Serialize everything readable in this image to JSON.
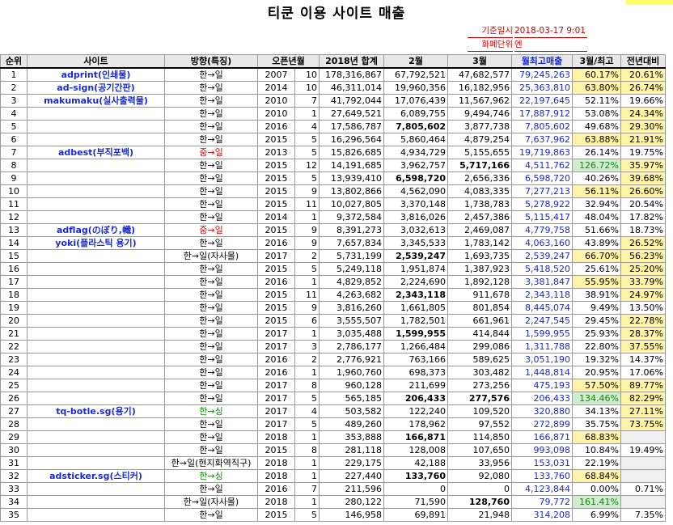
{
  "title": "티쿤 이용 사이트 매출",
  "meta": {
    "base_date_label": "기준일시",
    "base_date_value": "2018-03-17 9:01",
    "currency_label": "화폐단위",
    "currency_value": "엔"
  },
  "headers": [
    "순위",
    "사이트",
    "방향(특징)",
    "오픈년월",
    "2018년 합계",
    "2월",
    "3월",
    "월최고매출",
    "3월/최고",
    "전년대비"
  ],
  "rows": [
    {
      "rank": "1",
      "site": "adprint(인쇄물)",
      "dir": "한→일",
      "dirc": "",
      "y": "2007",
      "m": "10",
      "total": "178,316,867",
      "feb": "67,792,521",
      "mar": "47,682,577",
      "max": "79,245,263",
      "ratio": "60.17%",
      "rc": "ylw",
      "yoy": "20.61%",
      "yc": "ylw",
      "fb": false,
      "mb": false
    },
    {
      "rank": "2",
      "site": "ad-sign(공기간판)",
      "dir": "한→일",
      "dirc": "",
      "y": "2014",
      "m": "10",
      "total": "46,311,014",
      "feb": "19,960,356",
      "mar": "16,182,956",
      "max": "25,363,810",
      "ratio": "63.80%",
      "rc": "ylw",
      "yoy": "26.74%",
      "yc": "ylw",
      "fb": false,
      "mb": false
    },
    {
      "rank": "3",
      "site": "makumaku(실사출력물)",
      "dir": "한→일",
      "dirc": "",
      "y": "2010",
      "m": "7",
      "total": "41,792,044",
      "feb": "17,076,439",
      "mar": "11,567,962",
      "max": "22,197,645",
      "ratio": "52.11%",
      "rc": "",
      "yoy": "19.66%",
      "yc": "",
      "fb": false,
      "mb": false
    },
    {
      "rank": "4",
      "site": "",
      "dir": "한→일",
      "dirc": "",
      "y": "2010",
      "m": "1",
      "total": "27,649,521",
      "feb": "6,089,755",
      "mar": "9,494,746",
      "max": "17,887,912",
      "ratio": "53.08%",
      "rc": "",
      "yoy": "24.34%",
      "yc": "ylw",
      "fb": false,
      "mb": false
    },
    {
      "rank": "5",
      "site": "",
      "dir": "한→일",
      "dirc": "",
      "y": "2016",
      "m": "4",
      "total": "17,586,787",
      "feb": "7,805,602",
      "mar": "3,877,738",
      "max": "7,805,602",
      "ratio": "49.68%",
      "rc": "",
      "yoy": "29.30%",
      "yc": "ylw",
      "fb": true,
      "mb": false
    },
    {
      "rank": "6",
      "site": "",
      "dir": "한→일",
      "dirc": "",
      "y": "2015",
      "m": "5",
      "total": "16,296,564",
      "feb": "5,860,464",
      "mar": "4,879,254",
      "max": "7,637,962",
      "ratio": "63.88%",
      "rc": "ylw",
      "yoy": "21.91%",
      "yc": "ylw",
      "fb": false,
      "mb": false
    },
    {
      "rank": "7",
      "site": "adbest(부직포백)",
      "dir": "중→일",
      "dirc": "dir-red",
      "y": "2013",
      "m": "5",
      "total": "15,826,685",
      "feb": "4,934,729",
      "mar": "5,155,655",
      "max": "19,719,863",
      "ratio": "26.14%",
      "rc": "",
      "yoy": "19.75%",
      "yc": "",
      "fb": false,
      "mb": false
    },
    {
      "rank": "8",
      "site": "",
      "dir": "한→일",
      "dirc": "",
      "y": "2015",
      "m": "12",
      "total": "14,191,685",
      "feb": "3,962,757",
      "mar": "5,717,166",
      "max": "4,511,762",
      "ratio": "126.72%",
      "rc": "grn",
      "yoy": "35.97%",
      "yc": "ylw",
      "fb": false,
      "mb": true
    },
    {
      "rank": "9",
      "site": "",
      "dir": "한→일",
      "dirc": "",
      "y": "2015",
      "m": "5",
      "total": "13,939,410",
      "feb": "6,598,720",
      "mar": "2,656,336",
      "max": "6,598,720",
      "ratio": "40.26%",
      "rc": "",
      "yoy": "39.68%",
      "yc": "ylw",
      "fb": true,
      "mb": false
    },
    {
      "rank": "10",
      "site": "",
      "dir": "한→일",
      "dirc": "",
      "y": "2015",
      "m": "9",
      "total": "13,802,866",
      "feb": "4,562,090",
      "mar": "4,083,335",
      "max": "7,277,213",
      "ratio": "56.11%",
      "rc": "ylw",
      "yoy": "26.60%",
      "yc": "ylw",
      "fb": false,
      "mb": false
    },
    {
      "rank": "11",
      "site": "",
      "dir": "한→일",
      "dirc": "",
      "y": "2015",
      "m": "11",
      "total": "10,027,805",
      "feb": "3,370,148",
      "mar": "1,738,783",
      "max": "5,278,922",
      "ratio": "32.94%",
      "rc": "",
      "yoy": "20.54%",
      "yc": "",
      "fb": false,
      "mb": false
    },
    {
      "rank": "12",
      "site": "",
      "dir": "한→일",
      "dirc": "",
      "y": "2014",
      "m": "1",
      "total": "9,372,584",
      "feb": "3,816,026",
      "mar": "2,457,386",
      "max": "5,115,417",
      "ratio": "48.04%",
      "rc": "",
      "yoy": "17.82%",
      "yc": "",
      "fb": false,
      "mb": false
    },
    {
      "rank": "13",
      "site": "adflag(のぼり,幟)",
      "dir": "중→일",
      "dirc": "dir-red",
      "y": "2015",
      "m": "9",
      "total": "8,391,273",
      "feb": "3,032,613",
      "mar": "2,469,087",
      "max": "4,779,758",
      "ratio": "51.66%",
      "rc": "",
      "yoy": "18.73%",
      "yc": "",
      "fb": false,
      "mb": false
    },
    {
      "rank": "14",
      "site": "yoki(플라스틱 용기)",
      "dir": "한→일",
      "dirc": "",
      "y": "2016",
      "m": "9",
      "total": "7,657,834",
      "feb": "3,345,533",
      "mar": "1,783,142",
      "max": "4,063,160",
      "ratio": "43.89%",
      "rc": "",
      "yoy": "26.52%",
      "yc": "ylw",
      "fb": false,
      "mb": false
    },
    {
      "rank": "15",
      "site": "",
      "dir": "한→일(자사몰)",
      "dirc": "",
      "y": "2017",
      "m": "2",
      "total": "5,731,199",
      "feb": "2,539,247",
      "mar": "1,693,735",
      "max": "2,539,247",
      "ratio": "66.70%",
      "rc": "ylw",
      "yoy": "56.23%",
      "yc": "ylw",
      "fb": true,
      "mb": false
    },
    {
      "rank": "16",
      "site": "",
      "dir": "한→일",
      "dirc": "",
      "y": "2015",
      "m": "5",
      "total": "5,249,118",
      "feb": "1,951,874",
      "mar": "1,387,923",
      "max": "5,418,520",
      "ratio": "25.61%",
      "rc": "",
      "yoy": "25.20%",
      "yc": "ylw",
      "fb": false,
      "mb": false
    },
    {
      "rank": "17",
      "site": "",
      "dir": "한→일",
      "dirc": "",
      "y": "2016",
      "m": "1",
      "total": "4,829,852",
      "feb": "2,224,690",
      "mar": "1,892,128",
      "max": "3,381,847",
      "ratio": "55.95%",
      "rc": "ylw",
      "yoy": "33.79%",
      "yc": "ylw",
      "fb": false,
      "mb": false
    },
    {
      "rank": "18",
      "site": "",
      "dir": "한→일",
      "dirc": "",
      "y": "2015",
      "m": "11",
      "total": "4,263,682",
      "feb": "2,343,118",
      "mar": "911,678",
      "max": "2,343,118",
      "ratio": "38.91%",
      "rc": "",
      "yoy": "24.97%",
      "yc": "ylw",
      "fb": true,
      "mb": false
    },
    {
      "rank": "19",
      "site": "",
      "dir": "한→일",
      "dirc": "",
      "y": "2015",
      "m": "9",
      "total": "3,816,260",
      "feb": "1,661,805",
      "mar": "801,854",
      "max": "8,445,074",
      "ratio": "9.49%",
      "rc": "",
      "yoy": "13.50%",
      "yc": "",
      "fb": false,
      "mb": false
    },
    {
      "rank": "20",
      "site": "",
      "dir": "한→일",
      "dirc": "",
      "y": "2015",
      "m": "6",
      "total": "3,555,507",
      "feb": "1,782,501",
      "mar": "661,961",
      "max": "2,247,545",
      "ratio": "29.45%",
      "rc": "",
      "yoy": "22.78%",
      "yc": "ylw",
      "fb": false,
      "mb": false
    },
    {
      "rank": "21",
      "site": "",
      "dir": "한→일",
      "dirc": "",
      "y": "2017",
      "m": "1",
      "total": "3,035,488",
      "feb": "1,599,955",
      "mar": "414,844",
      "max": "1,599,955",
      "ratio": "25.93%",
      "rc": "",
      "yoy": "28.37%",
      "yc": "ylw",
      "fb": true,
      "mb": false
    },
    {
      "rank": "22",
      "site": "",
      "dir": "한→일",
      "dirc": "",
      "y": "2017",
      "m": "3",
      "total": "2,786,177",
      "feb": "1,266,484",
      "mar": "299,086",
      "max": "1,311,788",
      "ratio": "22.80%",
      "rc": "",
      "yoy": "37.55%",
      "yc": "ylw",
      "fb": false,
      "mb": false
    },
    {
      "rank": "23",
      "site": "",
      "dir": "한→일",
      "dirc": "",
      "y": "2016",
      "m": "2",
      "total": "2,776,921",
      "feb": "763,166",
      "mar": "589,625",
      "max": "3,051,190",
      "ratio": "19.32%",
      "rc": "",
      "yoy": "14.37%",
      "yc": "",
      "fb": false,
      "mb": false
    },
    {
      "rank": "24",
      "site": "",
      "dir": "한→일",
      "dirc": "",
      "y": "2016",
      "m": "1",
      "total": "1,960,760",
      "feb": "698,373",
      "mar": "303,482",
      "max": "1,448,814",
      "ratio": "20.95%",
      "rc": "",
      "yoy": "17.06%",
      "yc": "",
      "fb": false,
      "mb": false
    },
    {
      "rank": "25",
      "site": "",
      "dir": "한→일",
      "dirc": "",
      "y": "2017",
      "m": "8",
      "total": "960,128",
      "feb": "211,699",
      "mar": "273,256",
      "max": "475,193",
      "ratio": "57.50%",
      "rc": "ylw",
      "yoy": "89.77%",
      "yc": "ylw",
      "fb": false,
      "mb": false
    },
    {
      "rank": "26",
      "site": "",
      "dir": "한→일",
      "dirc": "",
      "y": "2017",
      "m": "5",
      "total": "565,185",
      "feb": "206,433",
      "mar": "277,576",
      "max": "206,433",
      "ratio": "134.46%",
      "rc": "grn",
      "yoy": "82.29%",
      "yc": "ylw",
      "fb": true,
      "mb": true
    },
    {
      "rank": "27",
      "site": "tq-botle.sg(용기)",
      "dir": "한→싱",
      "dirc": "dir-green",
      "y": "2017",
      "m": "4",
      "total": "503,582",
      "feb": "122,240",
      "mar": "109,520",
      "max": "320,880",
      "ratio": "34.13%",
      "rc": "",
      "yoy": "27.11%",
      "yc": "ylw",
      "fb": false,
      "mb": false
    },
    {
      "rank": "28",
      "site": "",
      "dir": "한→일",
      "dirc": "",
      "y": "2017",
      "m": "5",
      "total": "489,260",
      "feb": "178,962",
      "mar": "97,552",
      "max": "272,899",
      "ratio": "35.75%",
      "rc": "",
      "yoy": "73.75%",
      "yc": "ylw",
      "fb": false,
      "mb": false
    },
    {
      "rank": "29",
      "site": "",
      "dir": "한→일",
      "dirc": "",
      "y": "2018",
      "m": "1",
      "total": "353,888",
      "feb": "166,871",
      "mar": "114,850",
      "max": "166,871",
      "ratio": "68.83%",
      "rc": "ylw",
      "yoy": "",
      "yc": "gray",
      "fb": true,
      "mb": false
    },
    {
      "rank": "30",
      "site": "",
      "dir": "한→일",
      "dirc": "",
      "y": "2015",
      "m": "8",
      "total": "281,118",
      "feb": "128,008",
      "mar": "107,650",
      "max": "993,098",
      "ratio": "10.84%",
      "rc": "",
      "yoy": "19.49%",
      "yc": "",
      "fb": false,
      "mb": false
    },
    {
      "rank": "31",
      "site": "",
      "dir": "한→일(현지화역직구)",
      "dirc": "",
      "y": "2018",
      "m": "1",
      "total": "229,175",
      "feb": "42,188",
      "mar": "33,956",
      "max": "153,031",
      "ratio": "22.19%",
      "rc": "",
      "yoy": "",
      "yc": "gray",
      "fb": false,
      "mb": false
    },
    {
      "rank": "32",
      "site": "adsticker.sg(스티커)",
      "dir": "한→싱",
      "dirc": "dir-green",
      "y": "2018",
      "m": "1",
      "total": "227,440",
      "feb": "133,760",
      "mar": "92,080",
      "max": "133,760",
      "ratio": "68.84%",
      "rc": "ylw",
      "yoy": "",
      "yc": "gray",
      "fb": true,
      "mb": false
    },
    {
      "rank": "33",
      "site": "",
      "dir": "한→일",
      "dirc": "",
      "y": "2016",
      "m": "7",
      "total": "211,596",
      "feb": "0",
      "mar": "0",
      "max": "4,123,844",
      "ratio": "0.00%",
      "rc": "",
      "yoy": "0.71%",
      "yc": "",
      "fb": false,
      "mb": false
    },
    {
      "rank": "34",
      "site": "",
      "dir": "한→일(자사몰)",
      "dirc": "",
      "y": "2018",
      "m": "1",
      "total": "280,122",
      "feb": "71,590",
      "mar": "128,760",
      "max": "79,772",
      "ratio": "161.41%",
      "rc": "grn",
      "yoy": "",
      "yc": "gray",
      "fb": false,
      "mb": true
    },
    {
      "rank": "35",
      "site": "",
      "dir": "한→일",
      "dirc": "",
      "y": "2015",
      "m": "5",
      "total": "146,958",
      "feb": "69,891",
      "mar": "21,948",
      "max": "314,208",
      "ratio": "6.99%",
      "rc": "",
      "yoy": "7.35%",
      "yc": "",
      "fb": false,
      "mb": false
    }
  ]
}
